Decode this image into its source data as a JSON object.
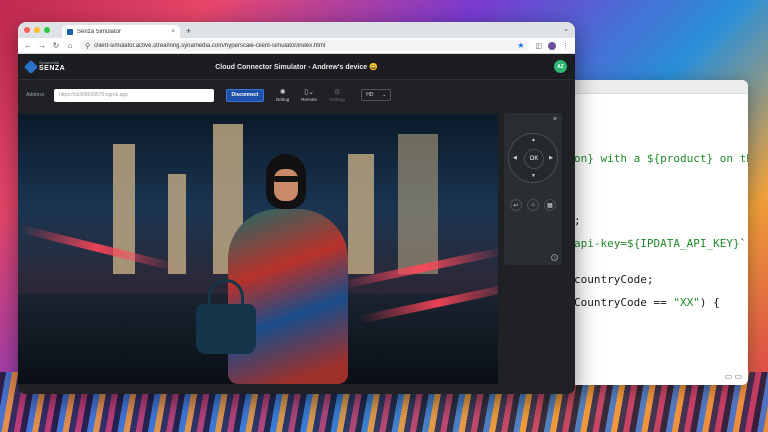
{
  "browser": {
    "tab_title": "Senza Simulator",
    "tab_close": "×",
    "new_tab": "+",
    "url": "client-simulator.active.streaming.synamedia.com/hyperscale-client-simulator/index.html",
    "icons": [
      "back-icon",
      "forward-icon",
      "reload-icon",
      "home-icon",
      "star-icon",
      "extensions-icon",
      "profile-icon",
      "menu-icon"
    ]
  },
  "app": {
    "logo_small": "Synamedia",
    "logo_big": "SENZA",
    "title": "Cloud Connector Simulator - Andrew's device 😀",
    "avatar_initials": "AZ",
    "address_label": "Address",
    "address_placeholder": "https://cb368639570.ngrok.app",
    "disconnect_label": "Disconnect",
    "tools": [
      {
        "label": "Debug",
        "icon": "bug-icon",
        "enabled": true
      },
      {
        "label": "Remote",
        "icon": "remote-icon",
        "enabled": true
      },
      {
        "label": "Settings",
        "icon": "gear-icon",
        "enabled": false
      }
    ],
    "resolution": "HD"
  },
  "remote": {
    "close": "×",
    "ok_label": "OK",
    "arrows": {
      "up": "▲",
      "down": "▼",
      "left": "◀",
      "right": "▶"
    },
    "back": "↩",
    "home": "⌂",
    "menu": "▦",
    "help": "?"
  },
  "editor": {
    "lines": [
      {
        "pre": "",
        "green": "on} with a ${product} on the",
        "post": ""
      },
      {
        "pre": ";",
        "green": "",
        "post": ""
      },
      {
        "pre": "",
        "green": "api-key=${IPDATA_API_KEY}",
        "post": "`;"
      },
      {
        "pre": "countryCode;",
        "green": "",
        "post": ""
      },
      {
        "pre": "CountryCode == ",
        "green": "\"XX\"",
        "post": ") {"
      }
    ]
  },
  "colors": {
    "accent": "#1e4fa8",
    "avatar": "#2bb673",
    "app_bg": "#1f2124",
    "code_string": "#1f8a2a"
  }
}
